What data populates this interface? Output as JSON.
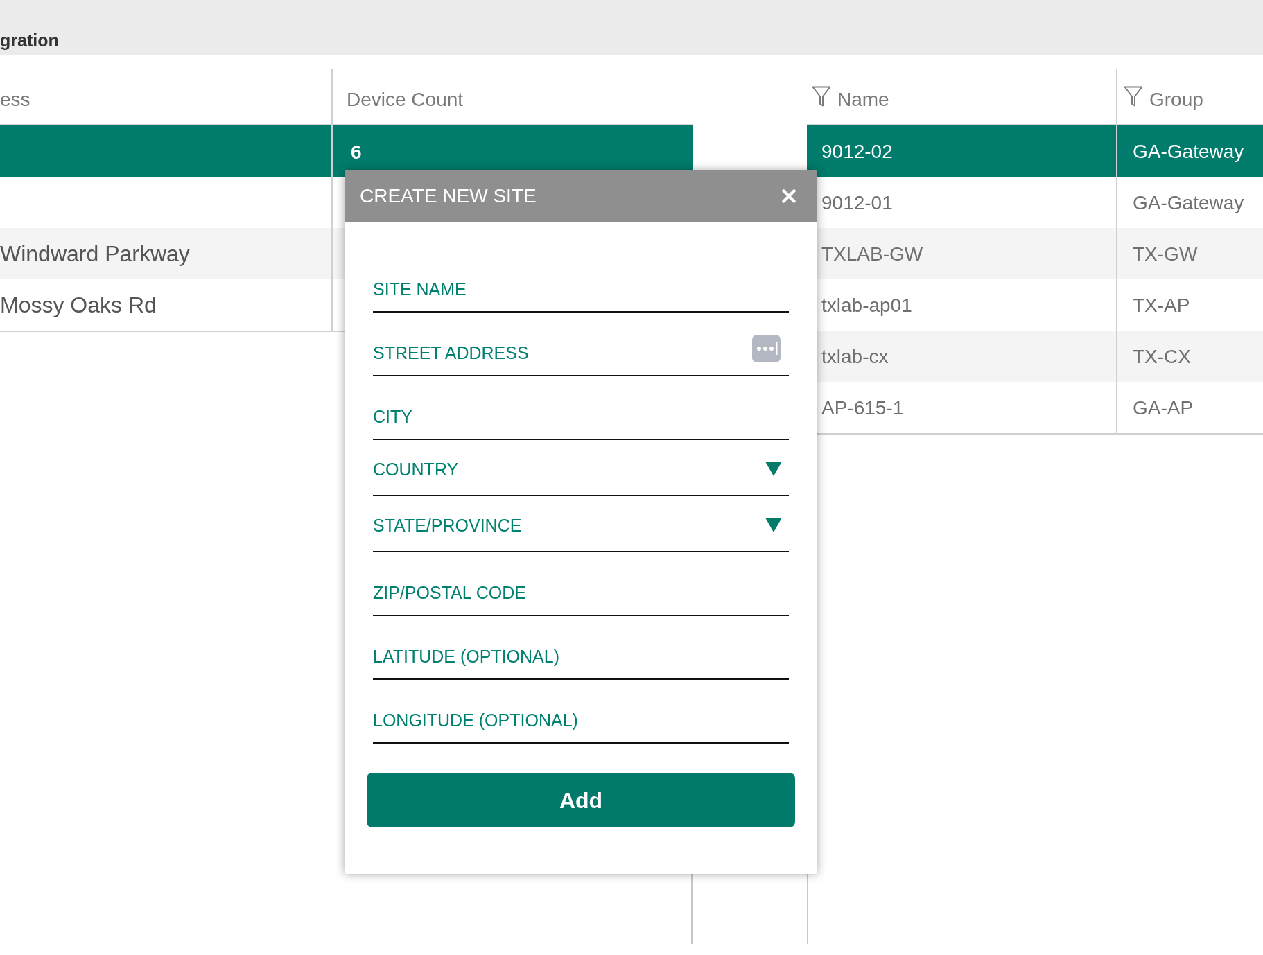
{
  "header": {
    "title": "gration"
  },
  "sites_table": {
    "columns": [
      "ess",
      "Device Count"
    ],
    "rows": [
      {
        "device_count": "6",
        "selected": true
      },
      {
        "selected": false
      },
      {
        "address": "Windward Parkway",
        "selected": false
      },
      {
        "address": "Mossy Oaks Rd",
        "selected": false
      }
    ]
  },
  "devices_table": {
    "columns": [
      {
        "label": "Name",
        "filter": true
      },
      {
        "label": "Group",
        "filter": true
      }
    ],
    "rows": [
      {
        "name": "9012-02",
        "group": "GA-Gateway",
        "selected": true
      },
      {
        "name": "9012-01",
        "group": "GA-Gateway",
        "selected": false
      },
      {
        "name": "TXLAB-GW",
        "group": "TX-GW",
        "selected": false
      },
      {
        "name": "txlab-ap01",
        "group": "TX-AP",
        "selected": false
      },
      {
        "name": "txlab-cx",
        "group": "TX-CX",
        "selected": false
      },
      {
        "name": "AP-615-1",
        "group": "GA-AP",
        "selected": false
      }
    ]
  },
  "dialog": {
    "title": "CREATE NEW SITE",
    "fields": [
      {
        "kind": "text",
        "placeholder": "SITE NAME"
      },
      {
        "kind": "text",
        "placeholder": "STREET ADDRESS",
        "autofill": true
      },
      {
        "kind": "text",
        "placeholder": "CITY"
      },
      {
        "kind": "select",
        "placeholder": "COUNTRY"
      },
      {
        "kind": "select",
        "placeholder": "STATE/PROVINCE"
      },
      {
        "kind": "text",
        "placeholder": "ZIP/POSTAL CODE"
      },
      {
        "kind": "text",
        "placeholder": "LATITUDE (OPTIONAL)"
      },
      {
        "kind": "text",
        "placeholder": "LONGITUDE (OPTIONAL)"
      }
    ],
    "submit": "Add"
  }
}
